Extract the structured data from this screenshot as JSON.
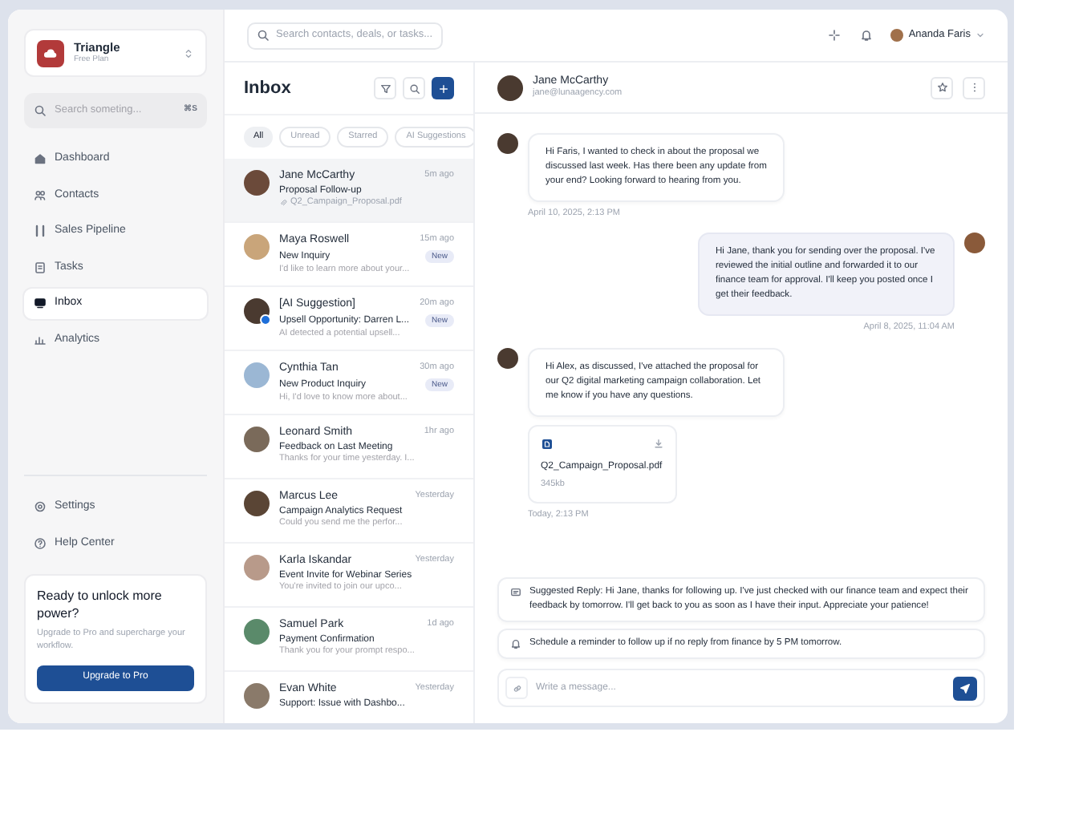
{
  "topbar": {
    "search_placeholder": "Search contacts, deals, or tasks...",
    "user": "Ananda Faris"
  },
  "sidebar": {
    "brand": {
      "name": "Triangle",
      "plan": "Free Plan"
    },
    "search": {
      "placeholder": "Search someting...",
      "shortcut": "⌘S"
    },
    "nav": [
      {
        "label": "Dashboard",
        "selected": false
      },
      {
        "label": "Contacts",
        "selected": false
      },
      {
        "label": "Sales Pipeline",
        "selected": false
      },
      {
        "label": "Tasks",
        "selected": false
      },
      {
        "label": "Inbox",
        "selected": true
      },
      {
        "label": "Analytics",
        "selected": false
      }
    ],
    "footer_nav": [
      {
        "label": "Settings"
      },
      {
        "label": "Help Center"
      }
    ],
    "upgrade": {
      "title": "Ready to unlock more power?",
      "text": "Upgrade to Pro and supercharge your workflow.",
      "button": "Upgrade to Pro"
    }
  },
  "inbox": {
    "title": "Inbox",
    "filters": [
      {
        "label": "All",
        "selected": true
      },
      {
        "label": "Unread",
        "selected": false
      },
      {
        "label": "Starred",
        "selected": false
      },
      {
        "label": "AI Suggestions",
        "selected": false
      }
    ],
    "conversations": [
      {
        "name": "Jane McCarthy",
        "time": "5m ago",
        "subject": "Proposal Follow-up",
        "attachment": "Q2_Campaign_Proposal.pdf",
        "selected": true
      },
      {
        "name": "Maya Roswell",
        "time": "15m ago",
        "subject": "New Inquiry",
        "preview": "I'd like to learn more about your...",
        "badge": "New",
        "selected": false
      },
      {
        "name": "[AI Suggestion]",
        "time": "20m ago",
        "subject": "Upsell Opportunity: Darren L...",
        "preview": "AI detected a potential upsell...",
        "badge": "New",
        "ai": true,
        "selected": false
      },
      {
        "name": "Cynthia Tan",
        "time": "30m ago",
        "subject": "New Product Inquiry",
        "preview": "Hi, I'd love to know more about...",
        "badge": "New",
        "selected": false
      },
      {
        "name": "Leonard Smith",
        "time": "1hr ago",
        "subject": "Feedback on Last Meeting",
        "preview": "Thanks for your time yesterday. I...",
        "selected": false
      },
      {
        "name": "Marcus Lee",
        "time": "Yesterday",
        "subject": "Campaign Analytics Request",
        "preview": "Could you send me the perfor...",
        "selected": false
      },
      {
        "name": "Karla Iskandar",
        "time": "Yesterday",
        "subject": "Event Invite for Webinar Series",
        "preview": "You're invited to join our upco...",
        "selected": false
      },
      {
        "name": "Samuel Park",
        "time": "1d ago",
        "subject": "Payment Confirmation",
        "preview": "Thank you for your prompt respo...",
        "selected": false
      },
      {
        "name": "Evan White",
        "time": "Yesterday",
        "subject": "Support: Issue with Dashbo...",
        "selected": false
      }
    ]
  },
  "chat": {
    "contact": {
      "name": "Jane McCarthy",
      "email": "jane@lunaagency.com"
    },
    "messages": [
      {
        "kind": "incoming",
        "text": "Hi Faris, I wanted to check in about the proposal we discussed last week. Has there been any update from your end? Looking forward to hearing from you.",
        "time": "April 10, 2025, 2:13 PM"
      },
      {
        "kind": "outgoing",
        "text": "Hi Jane, thank you for sending over the proposal. I've reviewed the initial outline and forwarded it to our finance team for approval. I'll keep you posted once I get their feedback.",
        "time": "April 8, 2025, 11:04 AM"
      },
      {
        "kind": "incoming",
        "text": "Hi Alex, as discussed, I've attached the proposal for our Q2 digital marketing campaign collaboration. Let me know if you have any questions.",
        "attachment": {
          "file_name": "Q2_Campaign_Proposal.pdf",
          "size": "345kb"
        },
        "time": "Today, 2:13 PM"
      }
    ],
    "suggestions": [
      {
        "kind": "reply",
        "text": "Suggested Reply: Hi Jane, thanks for following up. I've just checked with our finance team and expect their feedback by tomorrow. I'll get back to you as soon as I have their input. Appreciate your patience!"
      },
      {
        "kind": "reminder",
        "text": "Schedule a reminder to follow up if no reply from finance by 5 PM tomorrow."
      }
    ],
    "composer": {
      "placeholder": "Write a message..."
    }
  }
}
